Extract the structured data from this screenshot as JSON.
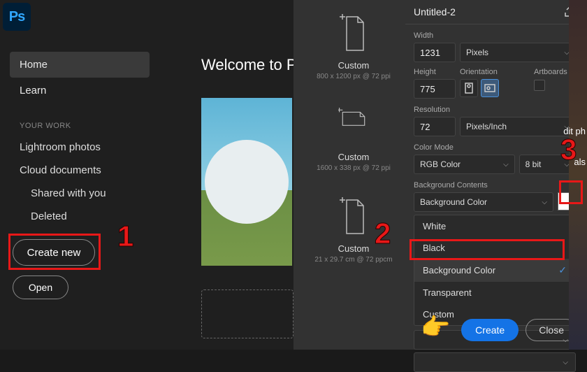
{
  "app": {
    "logo_text": "Ps"
  },
  "nav": {
    "home": "Home",
    "learn": "Learn",
    "section": "YOUR WORK",
    "lightroom": "Lightroom photos",
    "cloud": "Cloud documents",
    "shared": "Shared with you",
    "deleted": "Deleted"
  },
  "buttons": {
    "create_new": "Create new",
    "open": "Open",
    "create": "Create",
    "close": "Close"
  },
  "welcome": {
    "title": "Welcome to Phot"
  },
  "presets": [
    {
      "name": "Custom",
      "dims": "800 x 1200 px @ 72 ppi"
    },
    {
      "name": "Custom",
      "dims": "1600 x 338 px @ 72 ppi"
    },
    {
      "name": "Custom",
      "dims": "21 x 29.7 cm @ 72 ppcm"
    }
  ],
  "doc": {
    "title": "Untitled-2",
    "labels": {
      "width": "Width",
      "height": "Height",
      "orientation": "Orientation",
      "artboards": "Artboards",
      "resolution": "Resolution",
      "color_mode": "Color Mode",
      "bg": "Background Contents"
    },
    "width": "1231",
    "width_unit": "Pixels",
    "height": "775",
    "resolution": "72",
    "resolution_unit": "Pixels/Inch",
    "color_mode": "RGB Color",
    "bit_depth": "8 bit",
    "bg_selected": "Background Color",
    "bg_options": [
      "White",
      "Black",
      "Background Color",
      "Transparent",
      "Custom"
    ]
  },
  "edge": {
    "t1": "dit ph",
    "t2": "als"
  },
  "annotations": {
    "n1": "1",
    "n2": "2",
    "n3": "3"
  }
}
